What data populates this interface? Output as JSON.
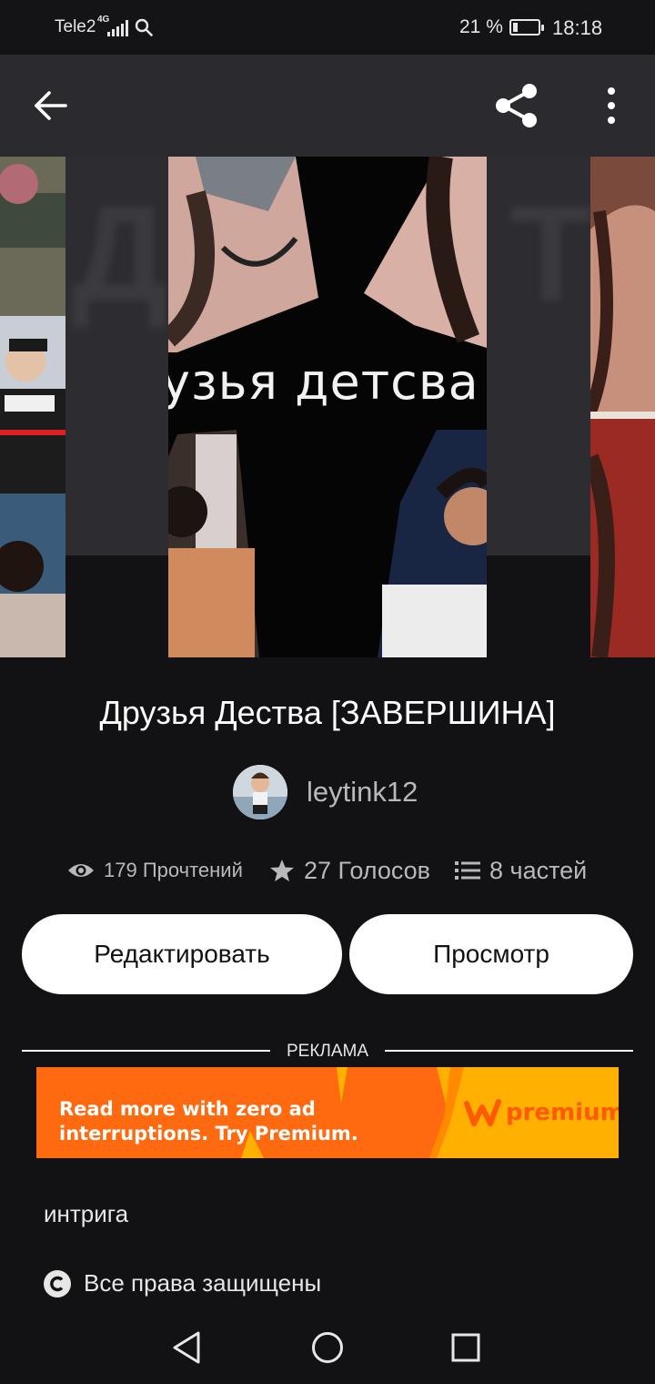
{
  "status_bar": {
    "carrier": "Tele2",
    "network": "4G",
    "battery_text": "21 %",
    "battery_level": 0.21,
    "time": "18:18"
  },
  "toolbar": {
    "back_icon": "arrow-left-icon",
    "share_icon": "share-icon",
    "more_icon": "more-vertical-icon"
  },
  "cover": {
    "title_text": "узья детсва"
  },
  "story": {
    "title": "Друзья Дества [ЗАВЕРШИНА]",
    "author": "leytink12"
  },
  "stats": {
    "reads": "179 Прочтений",
    "votes": "27 Голосов",
    "parts": "8 частей"
  },
  "actions": {
    "edit_label": "Редактировать",
    "view_label": "Просмотр"
  },
  "ad": {
    "label": "РЕКЛАМА",
    "line1": "Read more with zero ad",
    "line2": "interruptions. Try Premium.",
    "brand": "premium"
  },
  "details": {
    "tag": "интрига",
    "copyright": "Все права защищены"
  },
  "colors": {
    "background": "#121114",
    "toolbar": "#2b2a2e",
    "button_bg": "#ffffff",
    "muted_text": "#b9b8bc",
    "ad_orange": "#ff6a10",
    "ad_yellow": "#ffb000"
  }
}
